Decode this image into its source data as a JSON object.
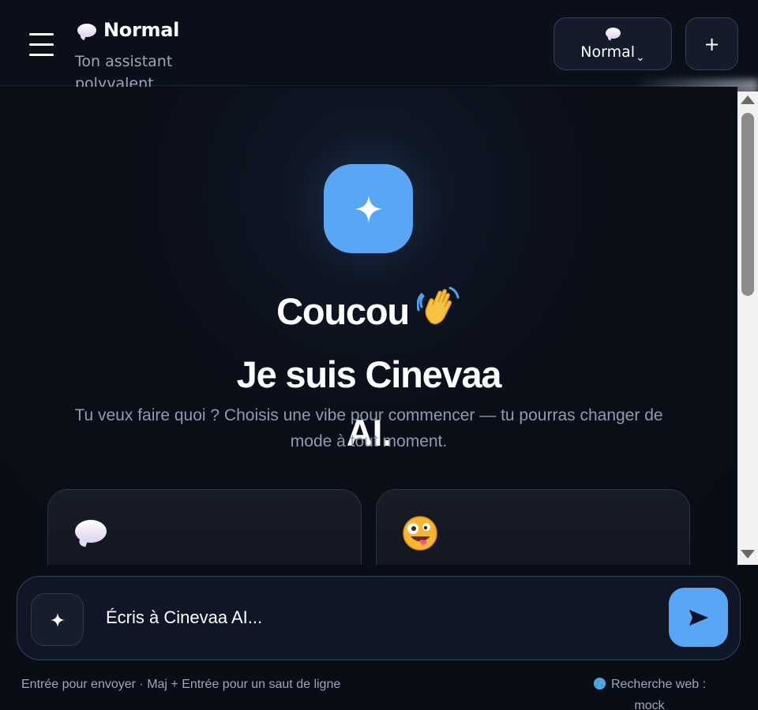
{
  "header": {
    "mode_title": "Normal",
    "mode_subtitle": "Ton assistant polyvalent",
    "mode_selector": {
      "selected": "Normal",
      "caret": "⌄"
    },
    "new_chat_label": "+"
  },
  "hero": {
    "greeting_line1": "Coucou",
    "greeting_line2": "Je suis Cinevaa AI.",
    "intro": "Tu veux faire quoi ? Choisis une vibe pour commencer — tu pourras changer de mode à tout moment."
  },
  "mode_cards": [
    {
      "icon": "speech-bubble-icon"
    },
    {
      "icon": "zany-face-icon"
    }
  ],
  "composer": {
    "placeholder": "Écris à Cinevaa AI...",
    "hint": "Entrée pour envoyer · Maj + Entrée pour un saut de ligne",
    "search_status": "Recherche web : mock"
  },
  "colors": {
    "background": "#090d16",
    "accent": "#5aa6f6",
    "panel": "#141b2a",
    "muted_text": "#9aa6ba"
  }
}
